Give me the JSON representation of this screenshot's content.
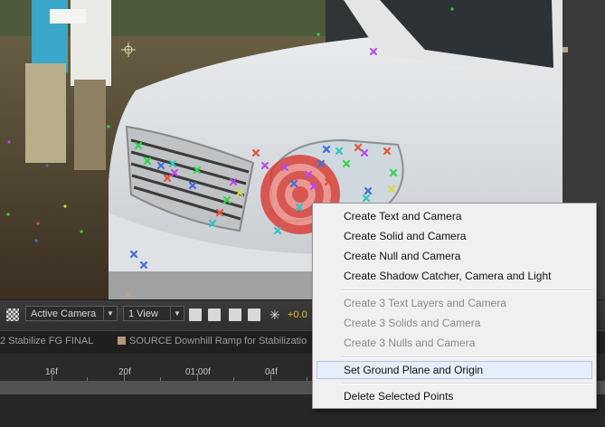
{
  "toolbar": {
    "camera_view": "Active Camera",
    "view_layout": "1 View",
    "exposure": "+0.0"
  },
  "timeline_tabs": [
    "2 Stabilize FG FINAL",
    "SOURCE Downhill Ramp for Stabilizatio"
  ],
  "ruler": {
    "labels": [
      "16f",
      "20f",
      "01:00f",
      "04f"
    ]
  },
  "context_menu": {
    "items": [
      "Create Text and Camera",
      "Create Solid and Camera",
      "Create Null and Camera",
      "Create Shadow Catcher, Camera and Light",
      "Create 3 Text Layers and Camera",
      "Create 3 Solids and Camera",
      "Create 3 Nulls and Camera",
      "Set Ground Plane and Origin",
      "Delete Selected Points"
    ],
    "disabled": [
      4,
      5,
      6
    ],
    "highlighted": 7
  },
  "colors": {
    "exposure": "#e3c04a",
    "menu_bg": "#f0f0f0",
    "menu_highlight": "#e6eef9",
    "target": "#d9413a"
  },
  "icons": [
    "transparency-grid-icon",
    "crosshair-icon",
    "exposure-icon",
    "fast-preview-icon",
    "snapshot-icon",
    "region-icon",
    "flowchart-icon"
  ]
}
